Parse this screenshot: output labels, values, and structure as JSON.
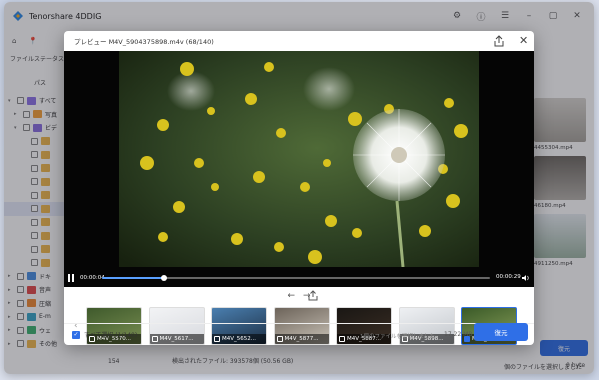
{
  "app": {
    "title": "Tenorshare 4DDIG",
    "controls": [
      "minimize",
      "maximize",
      "close"
    ]
  },
  "topbar": {
    "crumb": "ファイルステータス",
    "path_label": "パス"
  },
  "sidebar": {
    "items": [
      {
        "label": "すべて",
        "icon": "all-files-icon",
        "color": "#8e73e8"
      },
      {
        "label": "写真",
        "icon": "photo-icon",
        "color": "#f6a23a"
      },
      {
        "label": "ビデ",
        "icon": "video-icon",
        "color": "#8b6fe0"
      },
      {
        "label": "",
        "icon": "folder-icon",
        "color": "#f0b84d"
      },
      {
        "label": "",
        "icon": "folder-icon",
        "color": "#f0b84d"
      },
      {
        "label": "",
        "icon": "folder-icon",
        "color": "#f0b84d"
      },
      {
        "label": "",
        "icon": "folder-icon",
        "color": "#f0b84d"
      },
      {
        "label": "",
        "icon": "folder-icon",
        "color": "#f0b84d"
      },
      {
        "label": "",
        "icon": "folder-icon",
        "color": "#f0b84d"
      },
      {
        "label": "",
        "icon": "folder-icon",
        "color": "#f0b84d"
      },
      {
        "label": "",
        "icon": "folder-icon",
        "color": "#f0b84d"
      },
      {
        "label": "",
        "icon": "folder-icon",
        "color": "#f0b84d"
      },
      {
        "label": "",
        "icon": "folder-icon",
        "color": "#f0b84d"
      },
      {
        "label": "ドキ",
        "icon": "document-icon",
        "color": "#4a90e2"
      },
      {
        "label": "音声",
        "icon": "audio-icon",
        "color": "#e24a4a"
      },
      {
        "label": "圧縮",
        "icon": "archive-icon",
        "color": "#f08b35"
      },
      {
        "label": "E-m",
        "icon": "email-icon",
        "color": "#3aa7c8"
      },
      {
        "label": "ウェ",
        "icon": "web-icon",
        "color": "#3cb371"
      },
      {
        "label": "その他",
        "icon": "other-icon",
        "color": "#f0b84d"
      }
    ]
  },
  "right_panel": {
    "thumbs": [
      {
        "label": "4455304.mp4"
      },
      {
        "label": "46180.mp4"
      },
      {
        "label": "4911250.mp4"
      }
    ]
  },
  "status": {
    "count_label": "154",
    "total_label": "検出されたファイル: 393578個 (50.56 GB)",
    "selected_label": "個のファイルを選択しました",
    "size_label": "0 byte",
    "recover_label": "復元"
  },
  "dialog": {
    "title": "プレビュー M4V_5904375898.m4v (68/140)",
    "current_time": "00:00:04",
    "duration": "00:00:29",
    "progress": 0.16,
    "thumbnails": [
      {
        "label": "M4V_5570...",
        "checked": false
      },
      {
        "label": "M4V_5617...",
        "checked": false
      },
      {
        "label": "M4V_5652...",
        "checked": false
      },
      {
        "label": "M4V_5877...",
        "checked": false
      },
      {
        "label": "M4V_5887...",
        "checked": false
      },
      {
        "label": "M4V_5898...",
        "checked": false
      },
      {
        "label": "M4V_5904...",
        "checked": true
      }
    ],
    "select_all_label": "すべて選択 (1/140)",
    "selected_files": "1個のファイルを選択しました",
    "selected_size": "17.22 MB",
    "recover_label": "復元"
  },
  "colors": {
    "accent": "#2f6fe7",
    "video_bg": "#050505"
  }
}
